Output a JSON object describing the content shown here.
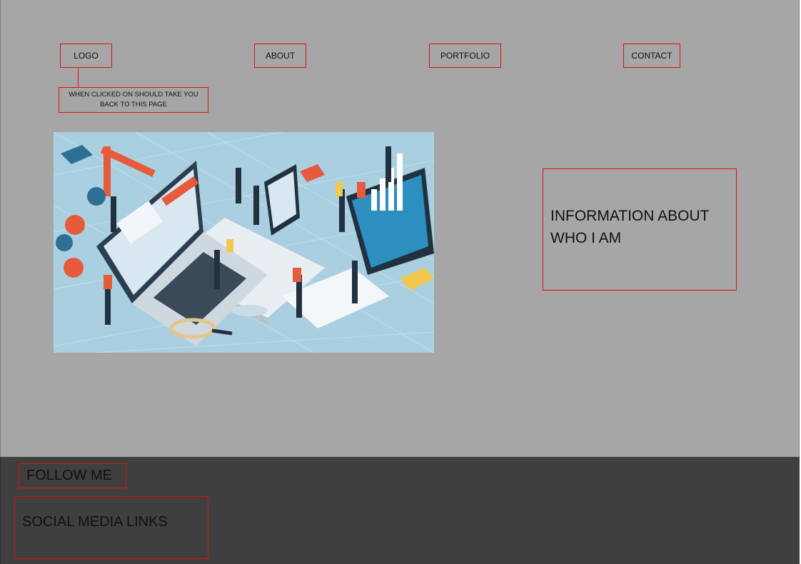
{
  "nav": {
    "logo": "LOGO",
    "about": "ABOUT",
    "portfolio": "PORTFOLIO",
    "contact": "CONTACT"
  },
  "logo_note": "WHEN CLICKED ON SHOULD TAKE YOU BACK TO THIS PAGE",
  "info_box": "INFORMATION ABOUT WHO I AM",
  "footer": {
    "follow": "FOLLOW ME",
    "social": "SOCIAL MEDIA LINKS"
  },
  "colors": {
    "page_bg": "#a6a6a6",
    "footer_bg": "#3f3f3f",
    "box_border": "#dd1111"
  },
  "hero_image": "isometric-web-development-illustration"
}
